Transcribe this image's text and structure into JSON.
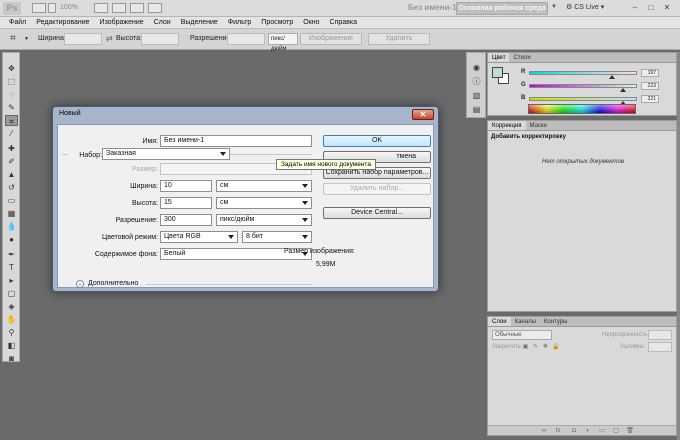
{
  "app": {
    "logo": "Ps",
    "zoom": "100%",
    "doc_title": "Без имени-1",
    "workspace": "Основная рабочая среда",
    "cs_live": "CS Live"
  },
  "menu": [
    "Файл",
    "Редактирование",
    "Изображение",
    "Слои",
    "Выделение",
    "Фильтр",
    "Просмотр",
    "Окно",
    "Справка"
  ],
  "options": {
    "width_label": "Ширина:",
    "height_label": "Высота:",
    "resolution_label": "Разрешение:",
    "unit_select": "пикс/дюйм",
    "image_btn": "Изображение",
    "delete_btn": "Удалить"
  },
  "color_panel": {
    "tabs": [
      "Цвет",
      "Стили"
    ],
    "channels": [
      {
        "name": "R",
        "value": "197",
        "fraction": 0.77
      },
      {
        "name": "G",
        "value": "223",
        "fraction": 0.87
      },
      {
        "name": "B",
        "value": "221",
        "fraction": 0.87
      }
    ],
    "fg_color": "#bedcd0"
  },
  "adjustments_panel": {
    "tabs": [
      "Коррекция",
      "Маски"
    ],
    "title": "Добавить корректировку",
    "empty_text": "Нет открытых документов"
  },
  "layers_panel": {
    "tabs": [
      "Слои",
      "Каналы",
      "Контуры"
    ],
    "blend_mode": "Обычные",
    "opacity_label": "Непрозрачность:",
    "lock_label": "Закрепить:",
    "fill_label": "Заливка:"
  },
  "dialog": {
    "title": "Новый",
    "name_label": "Имя:",
    "name_value": "Без имени-1",
    "tooltip": "Задать имя нового документа",
    "preset_label": "Набор:",
    "preset_value": "Заказная",
    "size_label": "Размер:",
    "width_label": "Ширина:",
    "width_value": "10",
    "width_unit": "см",
    "height_label": "Высота:",
    "height_value": "15",
    "height_unit": "см",
    "resolution_label": "Разрешение:",
    "resolution_value": "300",
    "resolution_unit": "пикс/дюйм",
    "color_mode_label": "Цветовой режим:",
    "color_mode_value": "Цвета RGB",
    "bit_depth_value": "8 бит",
    "background_label": "Содержимое фона:",
    "background_value": "Белый",
    "advanced_label": "Дополнительно",
    "ok_label": "OK",
    "cancel_label": "Отмена",
    "cancel_visible": "тмена",
    "save_preset_label": "Сохранить набор параметров...",
    "delete_preset_label": "Удалить набор...",
    "device_central_label": "Device Central...",
    "image_size_label": "Размер изображения:",
    "image_size_value": "5,99M"
  }
}
